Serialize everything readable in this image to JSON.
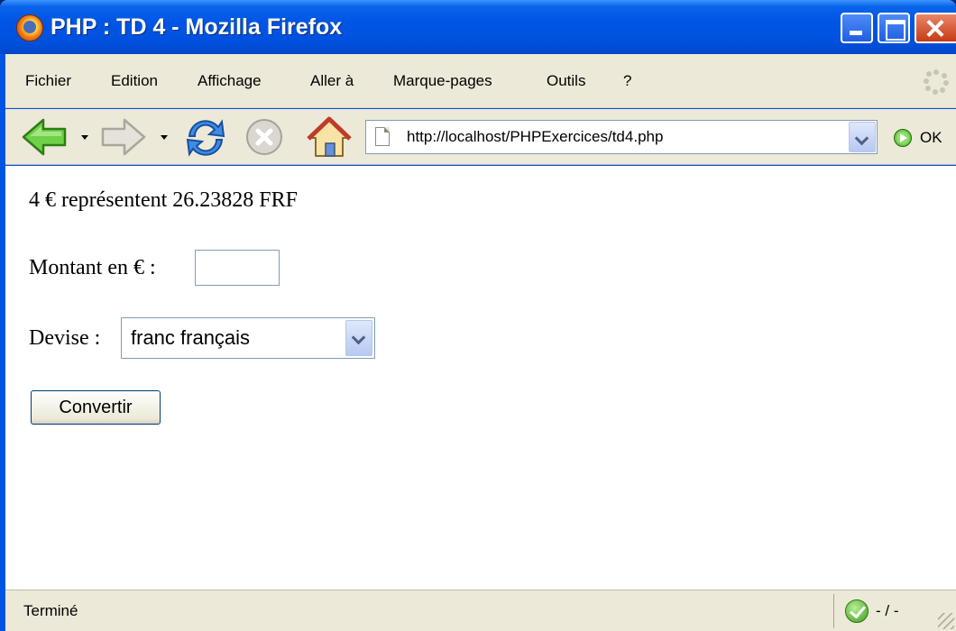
{
  "window": {
    "title": "PHP : TD 4 - Mozilla Firefox"
  },
  "menu": {
    "items": [
      {
        "label": "Fichier"
      },
      {
        "label": "Edition"
      },
      {
        "label": "Affichage"
      },
      {
        "label": "Aller à"
      },
      {
        "label": "Marque-pages"
      },
      {
        "label": "Outils"
      },
      {
        "label": "?"
      }
    ]
  },
  "toolbar": {
    "url": "http://localhost/PHPExercices/td4.php",
    "go_label": "OK",
    "icons": [
      "back-arrow-icon",
      "forward-arrow-icon",
      "reload-icon",
      "stop-icon",
      "home-icon",
      "page-icon",
      "go-icon"
    ]
  },
  "content": {
    "result_text": "4 € représentent 26.23828 FRF",
    "amount_label": "Montant en € :",
    "amount_value": "",
    "currency_label": "Devise :",
    "currency_selected": "franc français",
    "convert_label": "Convertir"
  },
  "status": {
    "text": "Terminé",
    "security": "- / -"
  },
  "colors": {
    "titlebar": "#0054e3",
    "chrome": "#ece9d8",
    "close_button": "#c63b14",
    "input_border": "#7f9db9"
  }
}
